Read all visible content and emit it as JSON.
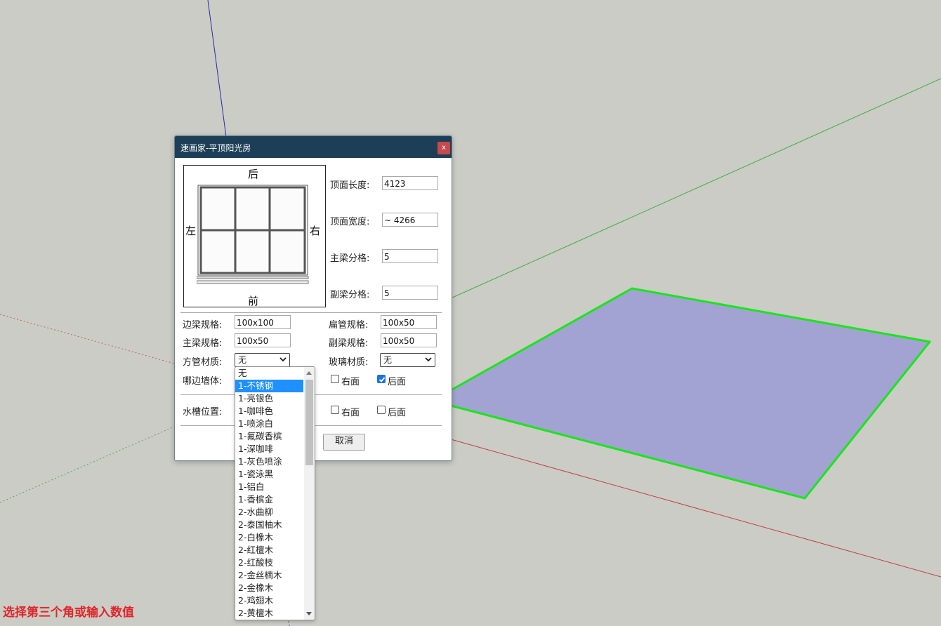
{
  "dialog": {
    "title": "速画家-平顶阳光房",
    "close_label": "x",
    "preview": {
      "back": "后",
      "front": "前",
      "left": "左",
      "right": "右"
    },
    "top_length": {
      "label": "顶面长度:",
      "value": "4123"
    },
    "top_width": {
      "label": "顶面宽度:",
      "value": "~ 4266"
    },
    "main_beam_div": {
      "label": "主梁分格:",
      "value": "5"
    },
    "sub_beam_div": {
      "label": "副梁分格:",
      "value": "5"
    },
    "edge_beam_spec": {
      "label": "边梁规格:",
      "value": "100x100"
    },
    "flat_tube_spec": {
      "label": "扁管规格:",
      "value": "100x50"
    },
    "main_beam_spec": {
      "label": "主梁规格:",
      "value": "100x50"
    },
    "sub_beam_spec": {
      "label": "副梁规格:",
      "value": "100x50"
    },
    "square_tube_material": {
      "label": "方管材质:",
      "value": "无"
    },
    "glass_material": {
      "label": "玻璃材质:",
      "value": "无"
    },
    "wall_side": {
      "label": "哪边墙体:",
      "right_label": "右面",
      "right_checked": false,
      "back_label": "后面",
      "back_checked": true
    },
    "gutter": {
      "label": "水槽位置:",
      "right_label": "右面",
      "right_checked": false,
      "back_label": "后面",
      "back_checked": false
    },
    "cancel_label": "取消"
  },
  "dropdown": {
    "selected": "1-不锈钢",
    "options": [
      "无",
      "1-不锈钢",
      "1-亮银色",
      "1-咖啡色",
      "1-喷涂白",
      "1-氟碳香槟",
      "1-深咖啡",
      "1-灰色喷涂",
      "1-瓷泳黑",
      "1-铝白",
      "1-香槟金",
      "2-水曲柳",
      "2-泰国柚木",
      "2-白橡木",
      "2-红檀木",
      "2-红酸枝",
      "2-金丝楠木",
      "2-金橡木",
      "2-鸡翅木",
      "2-黄檀木"
    ]
  },
  "status_text": "选择第三个角或输入数值",
  "colors": {
    "titlebar": "#1c3f57",
    "close": "#c64a4d",
    "plane_fill": "#a2a3d3",
    "plane_edge": "#19e619",
    "status": "#e0262a",
    "selection": "#1e90ff"
  }
}
